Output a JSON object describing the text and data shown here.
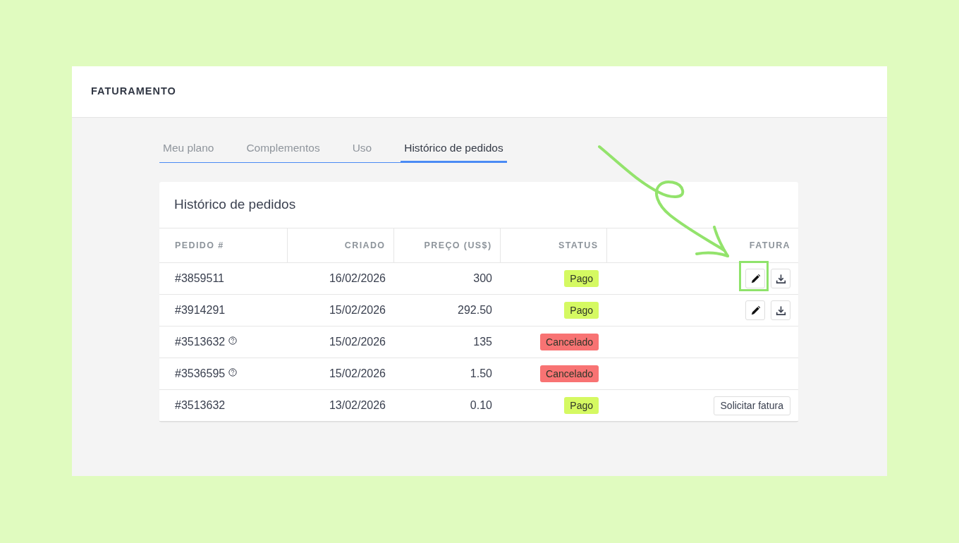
{
  "page": {
    "title": "FATURAMENTO"
  },
  "tabs": [
    {
      "label": "Meu plano",
      "selected": false
    },
    {
      "label": "Complementos",
      "selected": false
    },
    {
      "label": "Uso",
      "selected": false
    },
    {
      "label": "Histórico de pedidos",
      "selected": true
    }
  ],
  "orders_card": {
    "title": "Histórico de pedidos",
    "table": {
      "columns": [
        "PEDIDO #",
        "CRIADO",
        "PREÇO (US$)",
        "STATUS",
        "FATURA"
      ],
      "rows": [
        {
          "order": "#3859511",
          "help_icon": false,
          "created": "16/02/2026",
          "price": "300",
          "status": {
            "label": "Pago",
            "color": "#d5f962"
          },
          "invoice": {
            "kind": "actions",
            "highlighted": true
          }
        },
        {
          "order": "#3914291",
          "help_icon": false,
          "created": "15/02/2026",
          "price": "292.50",
          "status": {
            "label": "Pago",
            "color": "#d5f962"
          },
          "invoice": {
            "kind": "actions",
            "highlighted": false
          }
        },
        {
          "order": "#3513632",
          "help_icon": true,
          "created": "15/02/2026",
          "price": "135",
          "status": {
            "label": "Cancelado",
            "color": "#f87373"
          },
          "invoice": {
            "kind": "none"
          }
        },
        {
          "order": "#3536595",
          "help_icon": true,
          "created": "15/02/2026",
          "price": "1.50",
          "status": {
            "label": "Cancelado",
            "color": "#f87373"
          },
          "invoice": {
            "kind": "none"
          }
        },
        {
          "order": "#3513632",
          "help_icon": false,
          "created": "13/02/2026",
          "price": "0.10",
          "status": {
            "label": "Pago",
            "color": "#d5f962"
          },
          "invoice": {
            "kind": "request",
            "label": "Solicitar fatura"
          }
        }
      ]
    }
  },
  "annotation": {
    "kind": "arrow"
  }
}
